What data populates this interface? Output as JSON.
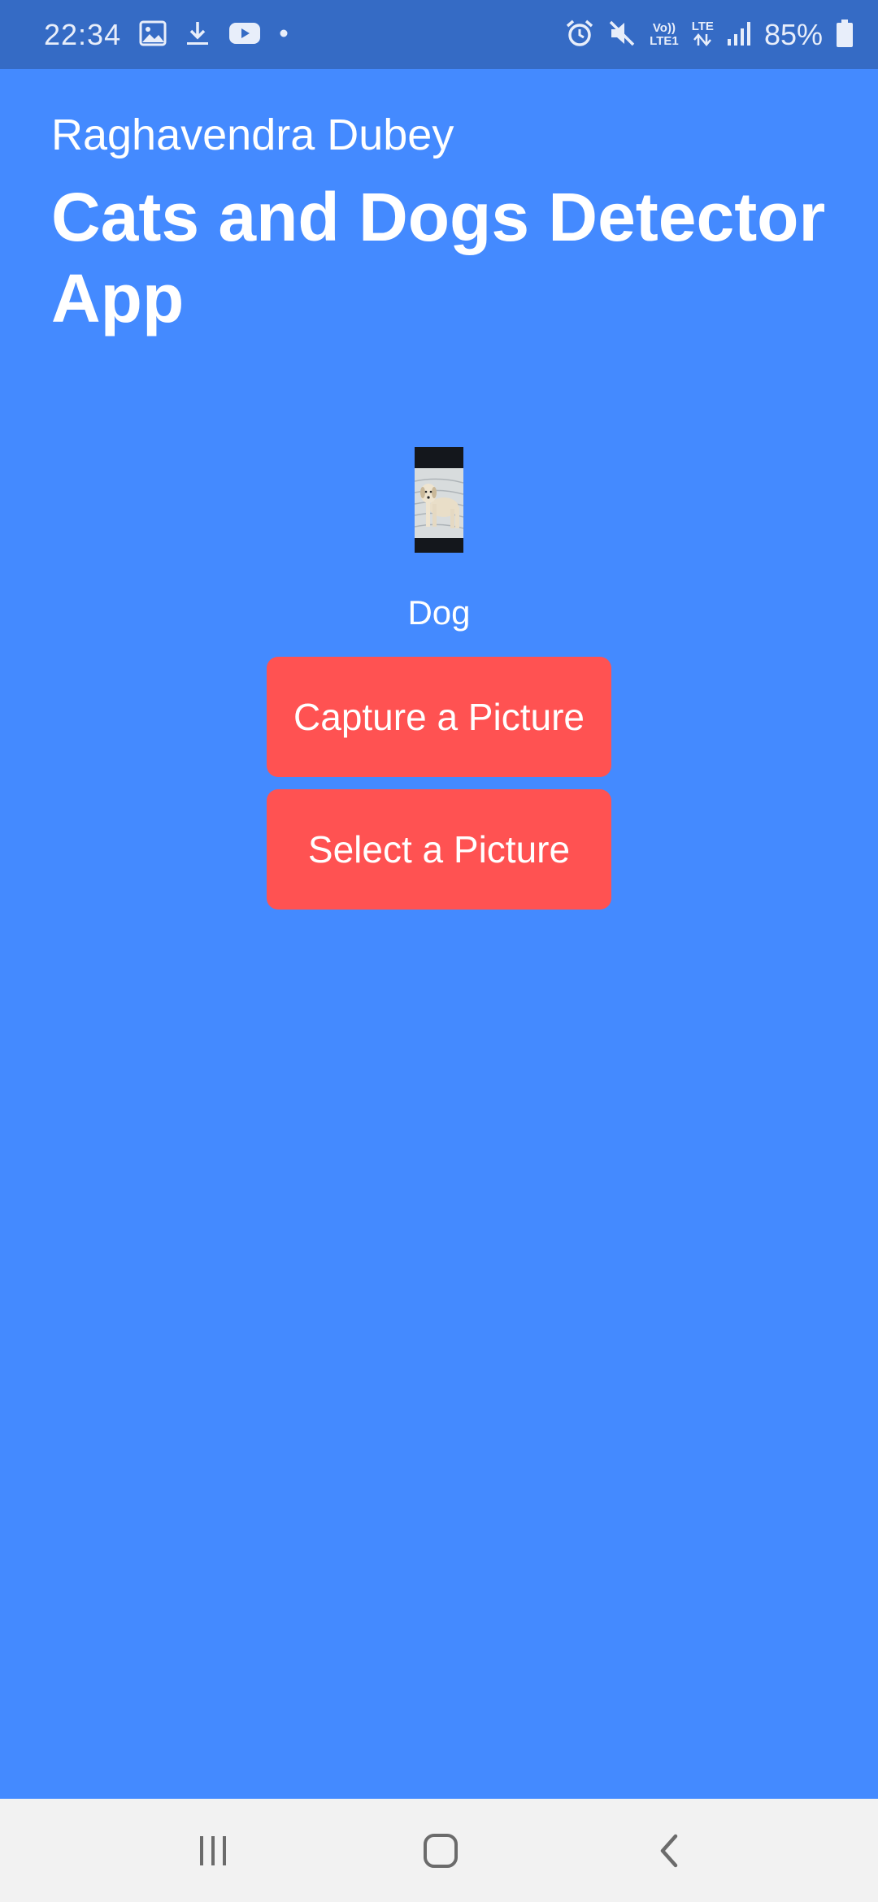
{
  "status_bar": {
    "time": "22:34",
    "left_icons": [
      "gallery-icon",
      "download-icon",
      "youtube-icon",
      "dot-icon"
    ],
    "right_icons": [
      "alarm-icon",
      "mute-icon",
      "volte-icon",
      "lte-data-icon",
      "signal-icon",
      "battery-icon"
    ],
    "network": {
      "volte_top": "Vo))",
      "volte_bottom": "LTE1",
      "lte": "LTE"
    },
    "battery": "85%"
  },
  "app": {
    "author": "Raghavendra Dubey",
    "title": "Cats and Dogs Detector App",
    "prediction": "Dog",
    "capture_label": "Capture a Picture",
    "select_label": "Select a Picture"
  },
  "nav_bar": {
    "buttons": [
      "recent-apps",
      "home",
      "back"
    ]
  },
  "colors": {
    "background": "#448AFF",
    "status_bar": "#356BC5",
    "button": "#FF5252",
    "nav_bar": "#F2F2F2"
  }
}
